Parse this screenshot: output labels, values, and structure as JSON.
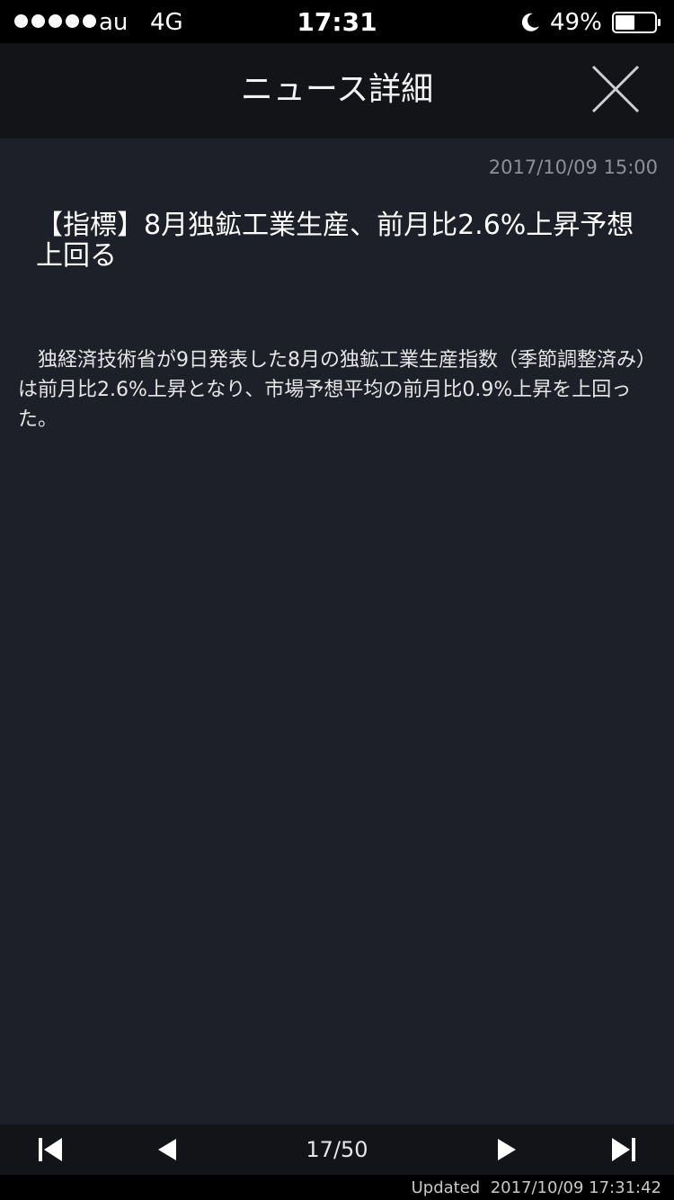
{
  "status_bar": {
    "carrier": "au",
    "network": "4G",
    "time": "17:31",
    "battery_percent": "49%",
    "battery_level": 0.49,
    "signal_bars": 5,
    "icons": [
      "signal-dots-icon",
      "moon-icon",
      "battery-icon"
    ]
  },
  "header": {
    "title": "ニュース詳細",
    "close_icon": "close-icon"
  },
  "article": {
    "date": "2017/10/09 15:00",
    "title": "【指標】8月独鉱工業生産、前月比2.6%上昇予想上回る",
    "body": "独経済技術省が9日発表した8月の独鉱工業生産指数（季節調整済み）は前月比2.6%上昇となり、市場予想平均の前月比0.9%上昇を上回った。"
  },
  "pager": {
    "page_label": "17/50",
    "icons": [
      "first-page-icon",
      "prev-page-icon",
      "next-page-icon",
      "last-page-icon"
    ]
  },
  "footer": {
    "updated_label": "Updated",
    "updated_time": "2017/10/09 17:31:42"
  },
  "colors": {
    "content_bg": "#1d2029",
    "header_bg": "#121418",
    "date_text": "#8c9099"
  }
}
